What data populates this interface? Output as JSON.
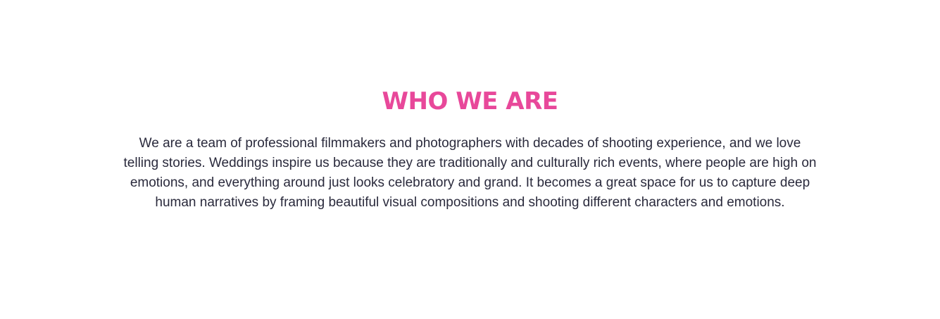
{
  "section": {
    "title": "WHO WE ARE",
    "paragraph": "We are a team of professional filmmakers and photographers with decades of shooting experience, and we love telling stories. Weddings inspire us because they are traditionally and culturally rich events, where people are high on emotions, and everything around just looks celebratory and grand. It becomes a great space for us to capture deep human narratives by framing beautiful visual compositions and shooting different characters and emotions."
  },
  "colors": {
    "background": "#ffffff",
    "accent": "#e8489a",
    "text": "#2a2a3c"
  }
}
